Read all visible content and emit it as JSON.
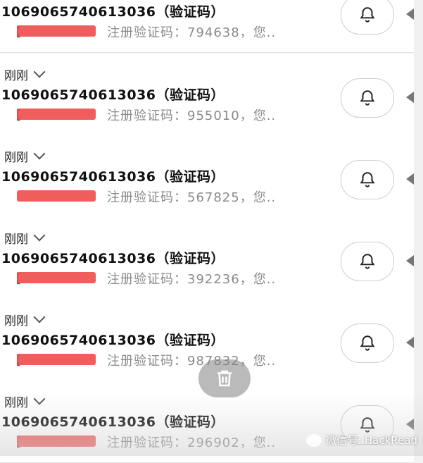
{
  "notifications": [
    {
      "time": "",
      "sender": "1069065740613036（验证码）",
      "bracket": "【",
      "preview": "注册验证码：794638，您.."
    },
    {
      "time": "刚刚",
      "sender": "1069065740613036（验证码）",
      "bracket": "【",
      "preview": "注册验证码：955010，您.."
    },
    {
      "time": "刚刚",
      "sender": "1069065740613036（验证码）",
      "bracket": "",
      "preview": "注册验证码：567825，您.."
    },
    {
      "time": "刚刚",
      "sender": "1069065740613036（验证码）",
      "bracket": "【",
      "preview": "注册验证码：392236，您.."
    },
    {
      "time": "刚刚",
      "sender": "1069065740613036（验证码）",
      "bracket": "【",
      "preview": "注册验证码：987832，您.."
    },
    {
      "time": "刚刚",
      "sender": "1069065740613036（验证码）",
      "bracket": "【",
      "preview": "注册验证码：296902，您.."
    }
  ],
  "watermark": {
    "text": "微信号: HackRead"
  },
  "icons": {
    "bell": "bell-icon",
    "trash": "trash-icon",
    "chevron": "chevron-down-icon"
  },
  "colors": {
    "redaction": "#ee4b4b",
    "card": "#ffffff",
    "preview_text": "#8a8a8a"
  }
}
